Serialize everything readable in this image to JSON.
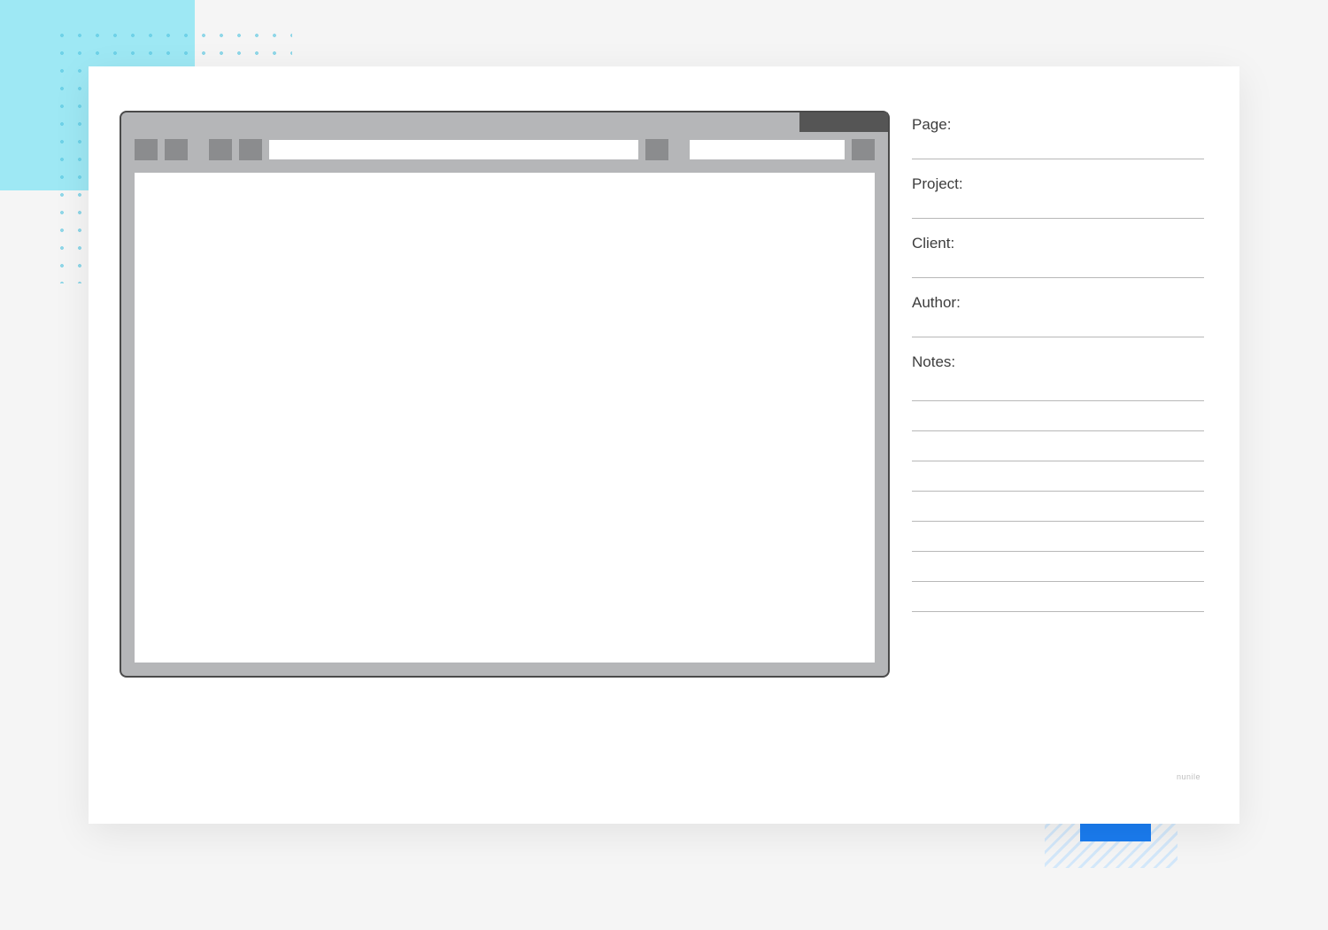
{
  "meta": {
    "fields": {
      "page": "Page:",
      "project": "Project:",
      "client": "Client:",
      "author": "Author:",
      "notes": "Notes:"
    }
  },
  "watermark": "nunile"
}
